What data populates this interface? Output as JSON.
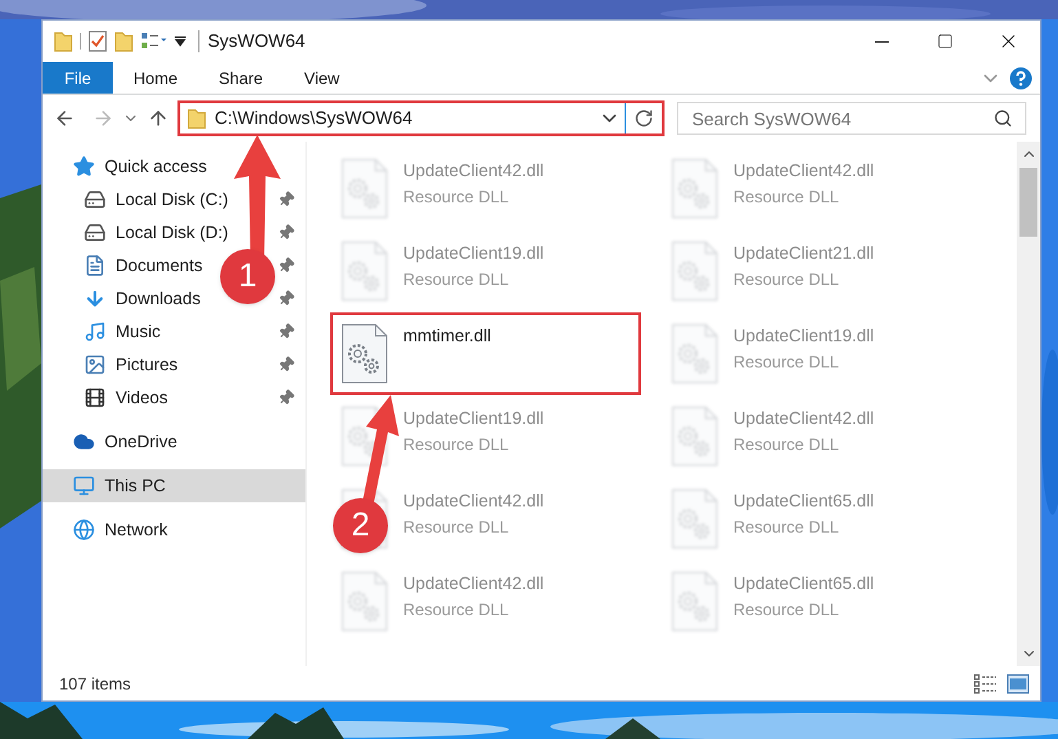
{
  "window": {
    "title": "SysWOW64"
  },
  "ribbon": {
    "tabs": [
      {
        "label": "File",
        "selected": true
      },
      {
        "label": "Home",
        "selected": false
      },
      {
        "label": "Share",
        "selected": false
      },
      {
        "label": "View",
        "selected": false
      }
    ]
  },
  "address_bar": {
    "value": "C:\\Windows\\SysWOW64",
    "highlighted": true
  },
  "search": {
    "placeholder": "Search SysWOW64"
  },
  "sidebar": {
    "items": [
      {
        "label": "Quick access",
        "kind": "star",
        "selected": false,
        "children": [
          {
            "label": "Local Disk (C:)",
            "kind": "system-drive",
            "pinned": true,
            "selected": false
          },
          {
            "label": "Local Disk (D:)",
            "kind": "drive",
            "pinned": true,
            "selected": false
          },
          {
            "label": "Documents",
            "kind": "documents",
            "pinned": true,
            "selected": false
          },
          {
            "label": "Downloads",
            "kind": "downloads",
            "pinned": true,
            "selected": false
          },
          {
            "label": "Music",
            "kind": "music",
            "pinned": true,
            "selected": false
          },
          {
            "label": "Pictures",
            "kind": "pictures",
            "pinned": true,
            "selected": false
          },
          {
            "label": "Videos",
            "kind": "videos",
            "pinned": true,
            "selected": false
          }
        ]
      },
      {
        "label": "OneDrive",
        "kind": "cloud",
        "selected": false
      },
      {
        "label": "This PC",
        "kind": "computer",
        "selected": true
      },
      {
        "label": "Network",
        "kind": "network",
        "selected": false
      }
    ]
  },
  "files": [
    {
      "name": "UpdateClient42.dll",
      "type": "Resource DLL",
      "faded": true,
      "highlighted": false
    },
    {
      "name": "UpdateClient42.dll",
      "type": "Resource DLL",
      "faded": true,
      "highlighted": false
    },
    {
      "name": "UpdateClient19.dll",
      "type": "Resource DLL",
      "faded": true,
      "highlighted": false
    },
    {
      "name": "UpdateClient21.dll",
      "type": "Resource DLL",
      "faded": true,
      "highlighted": false
    },
    {
      "name": "mmtimer.dll",
      "faded": false,
      "highlighted": true
    },
    {
      "name": "UpdateClient19.dll",
      "type": "Resource DLL",
      "faded": true,
      "highlighted": false
    },
    {
      "name": "UpdateClient19.dll",
      "type": "Resource DLL",
      "faded": true,
      "highlighted": false
    },
    {
      "name": "UpdateClient42.dll",
      "type": "Resource DLL",
      "faded": true,
      "highlighted": false
    },
    {
      "name": "UpdateClient42.dll",
      "type": "Resource DLL",
      "faded": true,
      "highlighted": false
    },
    {
      "name": "UpdateClient65.dll",
      "type": "Resource DLL",
      "faded": true,
      "highlighted": false
    },
    {
      "name": "UpdateClient42.dll",
      "type": "Resource DLL",
      "faded": true,
      "highlighted": false
    },
    {
      "name": "UpdateClient65.dll",
      "type": "Resource DLL",
      "faded": true,
      "highlighted": false
    }
  ],
  "status_bar": {
    "item_count": "107 items"
  },
  "annotations": [
    {
      "label": "1"
    },
    {
      "label": "2"
    }
  ]
}
